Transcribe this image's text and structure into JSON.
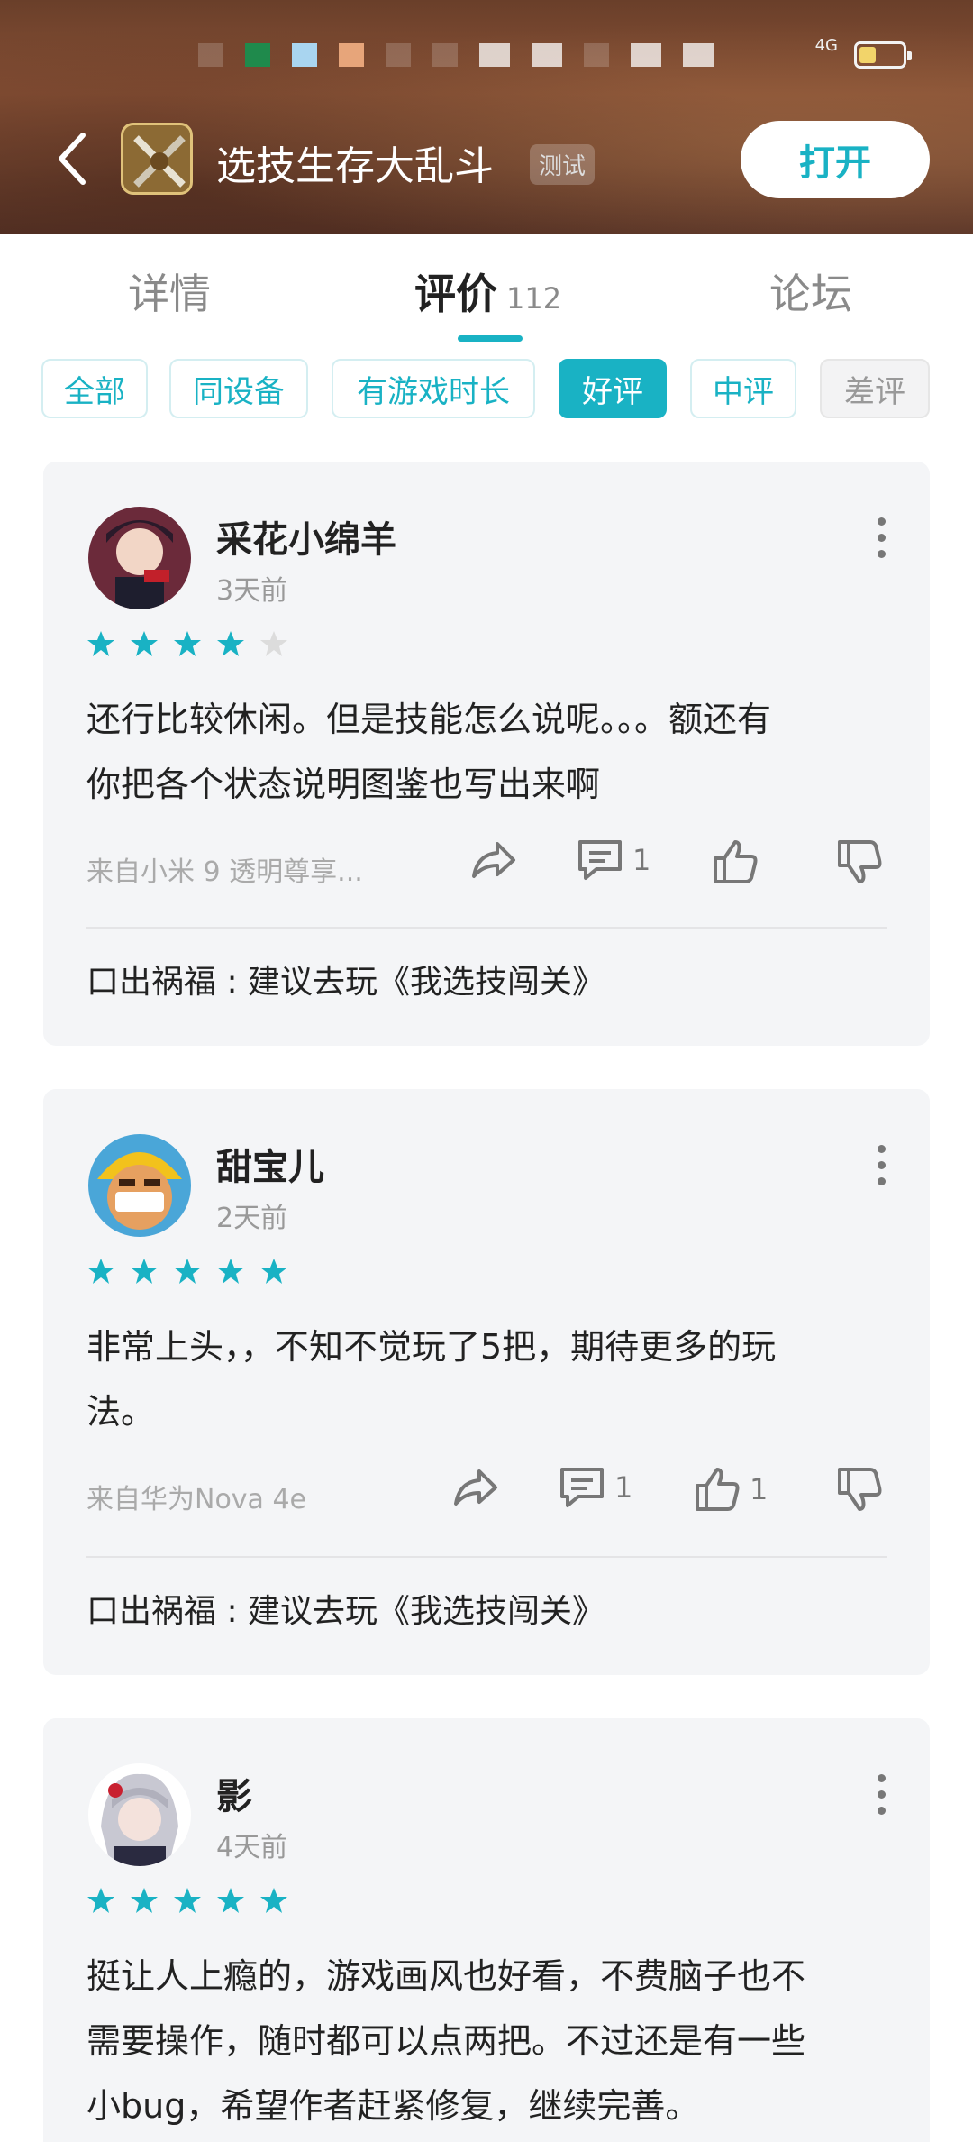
{
  "header": {
    "app_title": "选技生存大乱斗",
    "badge": "测试",
    "open_button": "打开",
    "signal_label": "4G",
    "accent": "#19b2c4"
  },
  "tabs": [
    {
      "label": "详情"
    },
    {
      "label": "评价",
      "count": "112",
      "active": true
    },
    {
      "label": "论坛"
    }
  ],
  "filters": [
    {
      "label": "全部"
    },
    {
      "label": "同设备"
    },
    {
      "label": "有游戏时长"
    },
    {
      "label": "好评",
      "active": true
    },
    {
      "label": "中评"
    },
    {
      "label": "差评",
      "disabled": true
    }
  ],
  "reviews": [
    {
      "user": "采花小绵羊",
      "time": "3天前",
      "rating": 4,
      "text_lines": [
        "还行比较休闲。但是技能怎么说呢。。。额还有",
        "你把各个状态说明图鉴也写出来啊"
      ],
      "device": "来自小米 9 透明尊享...",
      "comments": "1",
      "likes": "",
      "reply": "口出祸福 : 建议去玩《我选技闯关》"
    },
    {
      "user": "甜宝儿",
      "time": "2天前",
      "rating": 5,
      "text_lines": [
        "非常上头，，不知不觉玩了5把，期待更多的玩",
        "法。"
      ],
      "device": "来自华为Nova 4e",
      "comments": "1",
      "likes": "1",
      "reply": "口出祸福 : 建议去玩《我选技闯关》"
    },
    {
      "user": "影",
      "time": "4天前",
      "rating": 5,
      "text_lines": [
        "挺让人上瘾的，游戏画风也好看，不费脑子也不",
        "需要操作，随时都可以点两把。不过还是有一些",
        "小bug，希望作者赶紧修复，继续完善。"
      ]
    }
  ]
}
